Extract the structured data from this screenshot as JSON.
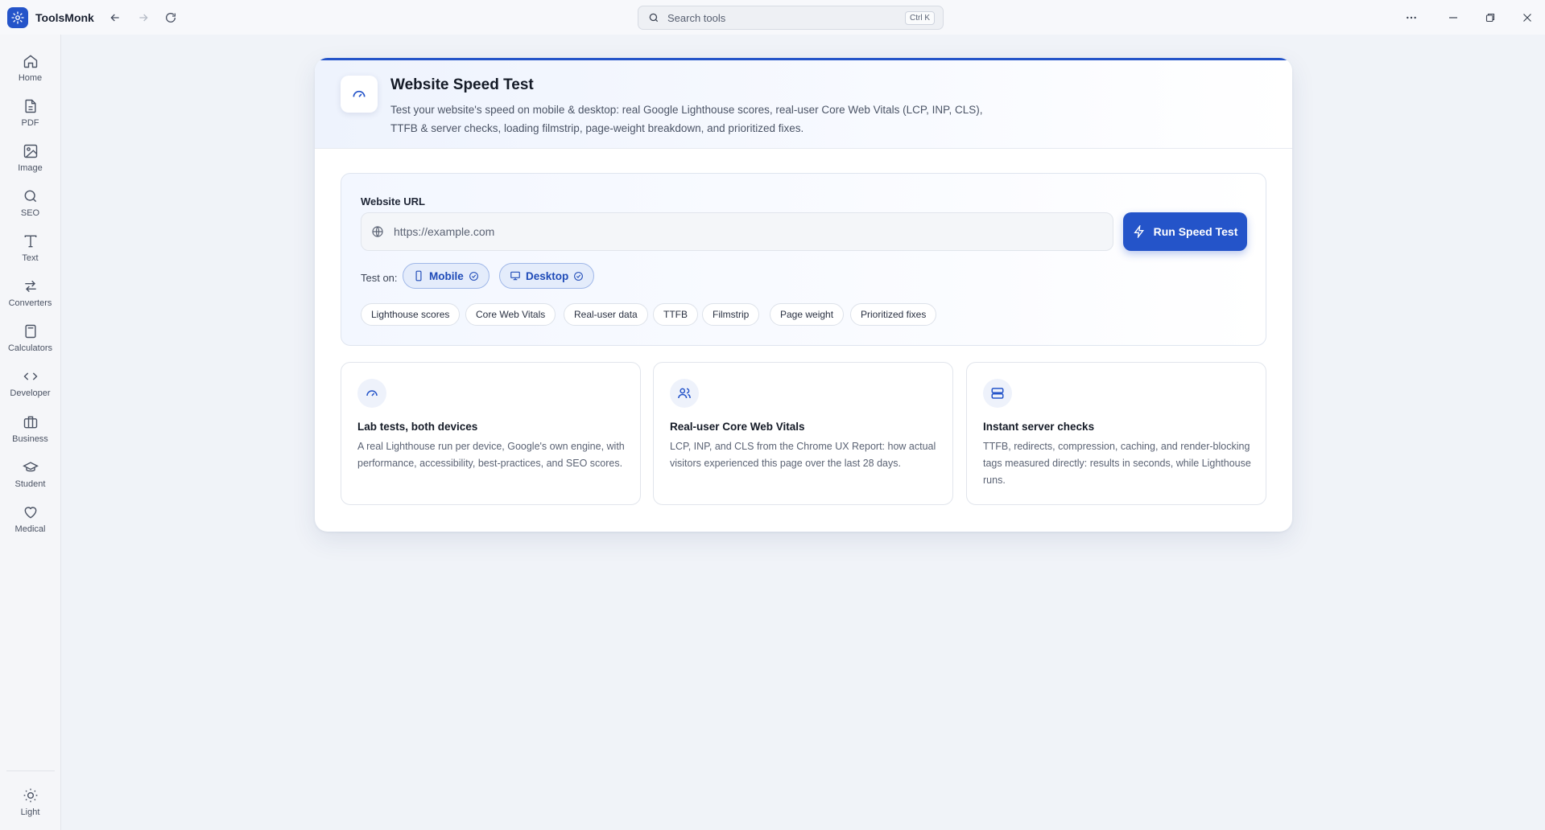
{
  "app": {
    "name": "ToolsMonk"
  },
  "search": {
    "placeholder": "Search tools",
    "shortcut": "Ctrl K"
  },
  "sidebar": {
    "items": [
      {
        "label": "Home",
        "icon": "home-icon"
      },
      {
        "label": "PDF",
        "icon": "file-icon"
      },
      {
        "label": "Image",
        "icon": "image-icon"
      },
      {
        "label": "SEO",
        "icon": "search-icon"
      },
      {
        "label": "Text",
        "icon": "text-icon"
      },
      {
        "label": "Converters",
        "icon": "arrows-icon"
      },
      {
        "label": "Calculators",
        "icon": "calculator-icon"
      },
      {
        "label": "Developer",
        "icon": "code-icon"
      },
      {
        "label": "Business",
        "icon": "briefcase-icon"
      },
      {
        "label": "Student",
        "icon": "graduation-cap-icon"
      },
      {
        "label": "Medical",
        "icon": "heart-icon"
      }
    ],
    "theme_toggle": {
      "label": "Light",
      "icon": "sun-icon"
    }
  },
  "tool": {
    "title": "Website Speed Test",
    "description": "Test your website's speed on mobile & desktop: real Google Lighthouse scores, real-user Core Web Vitals (LCP, INP, CLS), TTFB & server checks, loading filmstrip, page-weight breakdown, and prioritized fixes."
  },
  "form": {
    "url_label": "Website URL",
    "url_placeholder": "https://example.com",
    "url_value": "",
    "run_label": "Run Speed Test",
    "test_on_label": "Test on:",
    "devices": [
      {
        "label": "Mobile",
        "selected": true
      },
      {
        "label": "Desktop",
        "selected": true
      }
    ],
    "chips": [
      "Lighthouse scores",
      "Core Web Vitals",
      "Real-user data",
      "TTFB",
      "Filmstrip",
      "Page weight",
      "Prioritized fixes"
    ]
  },
  "features": [
    {
      "title": "Lab tests, both devices",
      "description": "A real Lighthouse run per device, Google's own engine, with performance, accessibility, best-practices, and SEO scores.",
      "icon": "gauge-icon"
    },
    {
      "title": "Real-user Core Web Vitals",
      "description": "LCP, INP, and CLS from the Chrome UX Report: how actual visitors experienced this page over the last 28 days.",
      "icon": "users-icon"
    },
    {
      "title": "Instant server checks",
      "description": "TTFB, redirects, compression, caching, and render-blocking tags measured directly: results in seconds, while Lighthouse runs.",
      "icon": "server-icon"
    }
  ],
  "colors": {
    "accent": "#2454c9",
    "background": "#f0f3f8"
  }
}
